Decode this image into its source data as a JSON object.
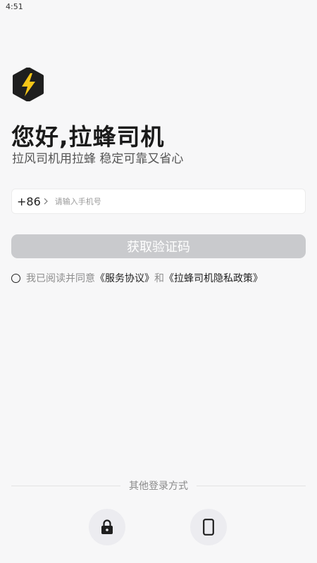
{
  "status_bar": {
    "time": "4:51"
  },
  "login": {
    "greeting": "您好,拉蜂司机",
    "subtitle": "拉风司机用拉蜂 稳定可靠又省心",
    "country_code": "+86",
    "phone_placeholder": "请输入手机号",
    "get_code_button": "获取验证码",
    "agreement_prefix": "我已阅读并同意",
    "service_agreement": "《服务协议》",
    "agreement_and": "和",
    "privacy_policy": "《拉蜂司机隐私政策》",
    "other_methods": "其他登录方式"
  },
  "colors": {
    "background": "#f7f7f8",
    "logo_bg": "#1f1f1f",
    "logo_bolt": "#f5c518",
    "button_disabled": "#c9cacd"
  },
  "icons": {
    "logo": "lightning-bolt-icon",
    "password_login": "lock-icon",
    "device_login": "phone-icon"
  }
}
